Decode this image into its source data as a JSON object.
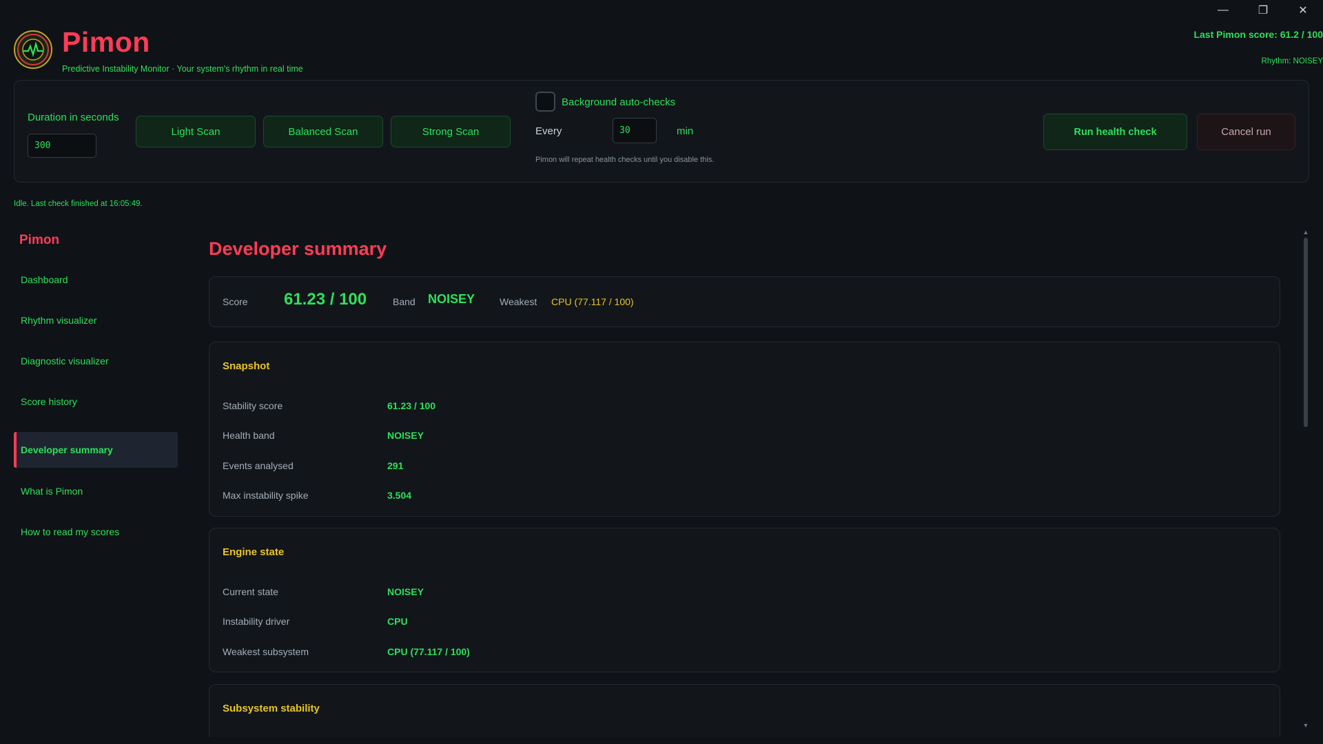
{
  "window": {
    "controls": {
      "minimize": "—",
      "restore": "❐",
      "close": "✕"
    }
  },
  "header": {
    "title": "Pimon",
    "subtitle": "Predictive Instability Monitor · Your system's rhythm in real time",
    "last_score": "Last Pimon score: 61.2 / 100",
    "rhythm": "Rhythm: NOISEY",
    "logo_icon": "heartbeat-gauge-icon"
  },
  "controls": {
    "duration_label": "Duration in seconds",
    "duration_value": "300",
    "scan_buttons": [
      "Light Scan",
      "Balanced Scan",
      "Strong Scan"
    ],
    "auto_checks_label": "Background auto-checks",
    "auto_checks_enabled": false,
    "every_label": "Every",
    "interval_value": "30",
    "interval_unit": "min",
    "hint": "Pimon will repeat health checks until you disable this.",
    "run_label": "Run health check",
    "cancel_label": "Cancel run"
  },
  "status": "Idle. Last check finished at 16:05:49.",
  "sidebar": {
    "title": "Pimon",
    "items": [
      {
        "label": "Dashboard",
        "active": false
      },
      {
        "label": "Rhythm visualizer",
        "active": false
      },
      {
        "label": "Diagnostic visualizer",
        "active": false
      },
      {
        "label": "Score history",
        "active": false
      },
      {
        "label": "Developer summary",
        "active": true
      },
      {
        "label": "What is Pimon",
        "active": false
      },
      {
        "label": "How to read my scores",
        "active": false
      }
    ]
  },
  "main": {
    "title": "Developer summary",
    "summary": {
      "score_label": "Score",
      "score_value": "61.23 / 100",
      "band_label": "Band",
      "band_value": "NOISEY",
      "weakest_label": "Weakest",
      "weakest_value": "CPU  (77.117 / 100)"
    },
    "snapshot": {
      "title": "Snapshot",
      "rows": [
        {
          "label": "Stability score",
          "value": "61.23 / 100"
        },
        {
          "label": "Health band",
          "value": "NOISEY"
        },
        {
          "label": "Events analysed",
          "value": "291"
        },
        {
          "label": "Max instability spike",
          "value": "3.504"
        }
      ]
    },
    "engine": {
      "title": "Engine state",
      "rows": [
        {
          "label": "Current state",
          "value": "NOISEY"
        },
        {
          "label": "Instability driver",
          "value": "CPU"
        },
        {
          "label": "Weakest subsystem",
          "value": "CPU  (77.117 / 100)"
        }
      ]
    },
    "subsystem": {
      "title": "Subsystem stability"
    }
  },
  "colors": {
    "accent_red": "#ff3c57",
    "accent_green": "#2ee05a",
    "accent_yellow": "#e9c428",
    "background": "#0f1216"
  }
}
